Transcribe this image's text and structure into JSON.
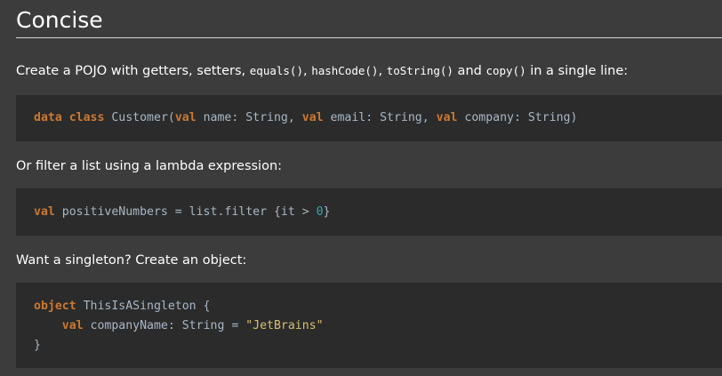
{
  "section": {
    "title": "Concise"
  },
  "p1": {
    "before": "Create a POJO with getters, setters, ",
    "code1": "equals()",
    "sep1": ", ",
    "code2": "hashCode()",
    "sep2": ", ",
    "code3": "toString()",
    "and": " and ",
    "code4": "copy()",
    "after": " in a single line:"
  },
  "code1": {
    "kw1": "data",
    "kw2": "class",
    "name": " Customer(",
    "val1": "val",
    "param1": " name: String, ",
    "val2": "val",
    "param2": " email: String, ",
    "val3": "val",
    "param3": " company: String)"
  },
  "p2": {
    "text": "Or filter a list using a lambda expression:"
  },
  "code2": {
    "kw": "val",
    "rest": " positiveNumbers = list.filter {it > ",
    "num": "0",
    "close": "}"
  },
  "p3": {
    "text": "Want a singleton? Create an object:"
  },
  "code3": {
    "kw_object": "object",
    "line1_rest": " ThisIsASingleton {",
    "indent": "    ",
    "kw_val": "val",
    "line2_rest": " companyName: String = ",
    "str": "\"JetBrains\"",
    "line3": "}"
  }
}
